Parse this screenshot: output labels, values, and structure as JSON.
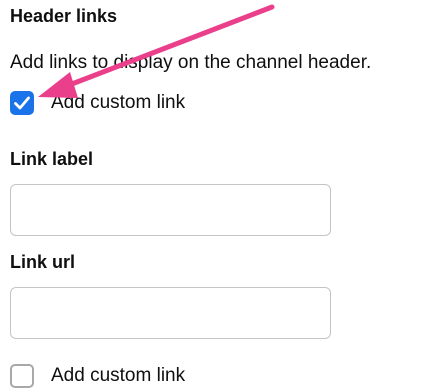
{
  "header_links": {
    "title": "Header links",
    "description": "Add links to display on the channel header.",
    "custom_link_1": {
      "label": "Add custom link",
      "checked": true
    },
    "link_label": {
      "label": "Link label",
      "value": ""
    },
    "link_url": {
      "label": "Link url",
      "value": ""
    },
    "custom_link_2": {
      "label": "Add custom link",
      "checked": false
    }
  },
  "colors": {
    "checkbox_checked": "#1a73e8",
    "annotation_arrow": "#ea3f8a"
  },
  "icons": {
    "checkmark": "check-icon",
    "annotation": "arrow-icon"
  }
}
